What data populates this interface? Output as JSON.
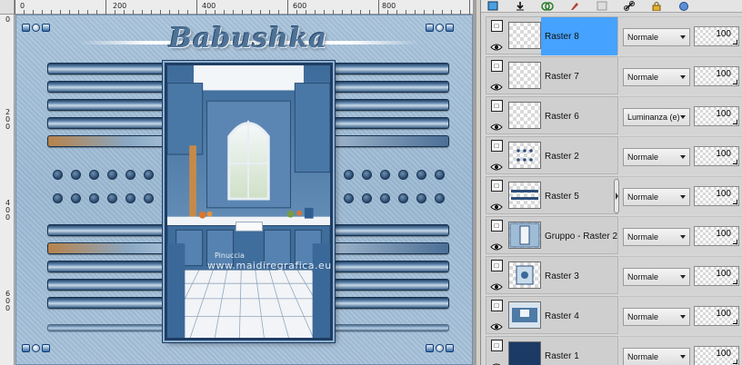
{
  "ruler": {
    "top_labels": [
      "0",
      "200",
      "400",
      "600",
      "800"
    ],
    "left_labels": [
      "0",
      "2",
      "0",
      "0",
      "4",
      "0",
      "0",
      "6",
      "0",
      "0"
    ]
  },
  "artwork": {
    "title": "Babushka",
    "watermark_line1": "Pinuccia",
    "watermark_line2": "www.maidiregrafica.eu"
  },
  "colors": {
    "canvas_bg": "#a9c4dc",
    "stripe_dark": "#1f3f63",
    "selection": "#46a2ff",
    "panel_bg": "#d6d6d6"
  },
  "toolbar": {
    "icons": [
      "new-layer-icon",
      "merge-down-icon",
      "link-group-icon",
      "paint-icon",
      "mask-icon",
      "chain-link-icon",
      "lock-icon",
      "ball-icon"
    ]
  },
  "layers": [
    {
      "name": "Raster 8",
      "blend": "Normale",
      "opacity": "100",
      "selected": true,
      "thumb": "empty"
    },
    {
      "name": "Raster 7",
      "blend": "Normale",
      "opacity": "100",
      "selected": false,
      "thumb": "empty"
    },
    {
      "name": "Raster 6",
      "blend": "Luminanza (e)",
      "opacity": "100",
      "selected": false,
      "thumb": "empty"
    },
    {
      "name": "Raster 2",
      "blend": "Normale",
      "opacity": "100",
      "selected": false,
      "thumb": "dots"
    },
    {
      "name": "Raster 5",
      "blend": "Normale",
      "opacity": "100",
      "selected": false,
      "thumb": "stripes"
    },
    {
      "name": "Gruppo - Raster 2",
      "blend": "Normale",
      "opacity": "100",
      "selected": false,
      "thumb": "frame"
    },
    {
      "name": "Raster 3",
      "blend": "Normale",
      "opacity": "100",
      "selected": false,
      "thumb": "deco"
    },
    {
      "name": "Raster 4",
      "blend": "Normale",
      "opacity": "100",
      "selected": false,
      "thumb": "kitchen"
    },
    {
      "name": "Raster 1",
      "blend": "Normale",
      "opacity": "100",
      "selected": false,
      "thumb": "solid"
    }
  ]
}
